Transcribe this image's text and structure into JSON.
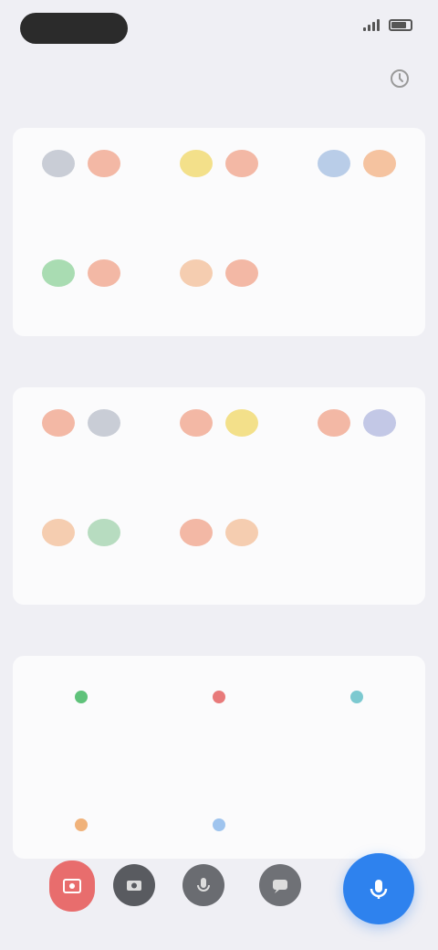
{
  "status_bar": {
    "time": ""
  },
  "header": {
    "tab_left": "",
    "tab_center": "",
    "action_icon": "history-icon"
  },
  "section1": {
    "items": [
      {
        "from": "",
        "to": "",
        "label": "",
        "from_color": "#c9cdd6",
        "to_color": "#f3b8a5"
      },
      {
        "from": "",
        "to": "",
        "label": "",
        "from_color": "#f3e08a",
        "to_color": "#f3b8a5"
      },
      {
        "from": "",
        "to": "",
        "label": "",
        "from_color": "#b9cde8",
        "to_color": "#f5c3a0"
      },
      {
        "from": "",
        "to": "",
        "label": "",
        "from_color": "#a9dcb2",
        "to_color": "#f3b8a5"
      },
      {
        "from": "",
        "to": "",
        "label": "",
        "from_color": "#f5cdb0",
        "to_color": "#f3b8a5"
      }
    ]
  },
  "section2": {
    "title": "",
    "items": [
      {
        "from": "",
        "to": "",
        "label": "",
        "from_color": "#f3b8a5",
        "to_color": "#c9cdd6"
      },
      {
        "from": "",
        "to": "",
        "label": "",
        "from_color": "#f3b8a5",
        "to_color": "#f3e08a"
      },
      {
        "from": "",
        "to": "",
        "label": "",
        "from_color": "#f3b8a5",
        "to_color": "#c3c8e6"
      },
      {
        "from": "",
        "to": "",
        "label": "",
        "from_color": "#f5cdb0",
        "to_color": "#b7dcc0"
      },
      {
        "from": "",
        "to": "",
        "label": "",
        "from_color": "#f3b8a5",
        "to_color": "#f5cdb0"
      }
    ]
  },
  "section3": {
    "title": "",
    "tools": [
      {
        "icon": "green-tool-icon",
        "label": "",
        "color": "#5fc27a"
      },
      {
        "icon": "red-tool-icon",
        "label": "",
        "color": "#e87a7a"
      },
      {
        "icon": "teal-tool-icon",
        "label": "",
        "color": "#7cc9d0"
      },
      {
        "icon": "orange-tool-icon",
        "label": "",
        "color": "#f0b27a"
      },
      {
        "icon": "blue-tool-icon",
        "label": "",
        "color": "#9fc4ee"
      }
    ]
  },
  "bottom": {
    "hint": "",
    "buttons": [
      "photo-icon",
      "camera-icon",
      "microphone-icon",
      "chat-icon"
    ],
    "fab_icon": "voice-translate-icon",
    "accent": "#2e82ee"
  }
}
